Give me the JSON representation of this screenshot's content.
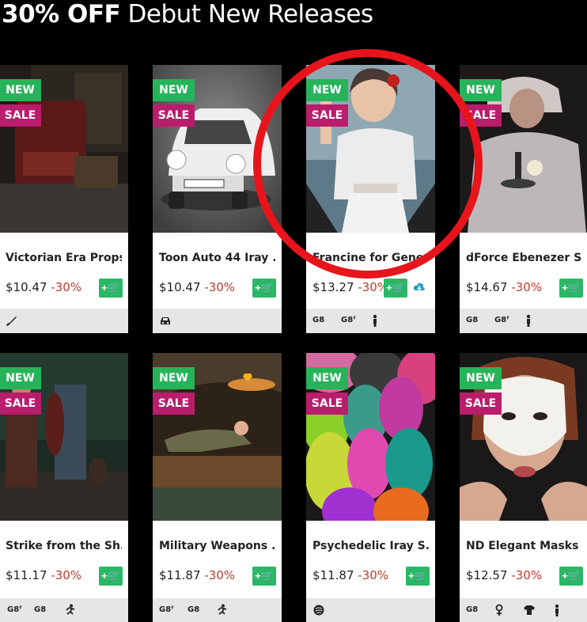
{
  "heading": {
    "bold": "30% OFF",
    "rest": " Debut New Releases"
  },
  "badges": {
    "new": "NEW",
    "sale": "SALE"
  },
  "products": [
    {
      "title": "Victorian Era Props",
      "price": "$10.47",
      "discount": "-30%",
      "cart": "+🛒",
      "tags": [
        "sword-icon"
      ]
    },
    {
      "title": "Toon Auto 44 Iray ...",
      "price": "$10.47",
      "discount": "-30%",
      "cart": "+🛒",
      "tags": [
        "car-icon"
      ]
    },
    {
      "title": "Francine for Gene...",
      "price": "$13.27",
      "discount": "-30%",
      "cart": "+🛒",
      "tags": [
        "G8",
        "G8f",
        "figure-icon"
      ]
    },
    {
      "title": "dForce Ebenezer S...",
      "price": "$14.67",
      "discount": "-30%",
      "cart": "+🛒",
      "tags": [
        "G8",
        "G8f",
        "figure-icon"
      ]
    },
    {
      "title": "Strike from the Sh...",
      "price": "$11.17",
      "discount": "-30%",
      "cart": "+🛒",
      "tags": [
        "G8f",
        "G8",
        "running-icon"
      ]
    },
    {
      "title": "Military Weapons ...",
      "price": "$11.87",
      "discount": "-30%",
      "cart": "+🛒",
      "tags": [
        "G8f",
        "G8",
        "running-icon"
      ]
    },
    {
      "title": "Psychedelic Iray S...",
      "price": "$11.87",
      "discount": "-30%",
      "cart": "+🛒",
      "tags": [
        "shader-icon"
      ]
    },
    {
      "title": "ND Elegant Masks ...",
      "price": "$12.57",
      "discount": "-30%",
      "cart": "+🛒",
      "tags": [
        "G8",
        "female-icon",
        "shirt-icon",
        "figure-icon"
      ]
    }
  ],
  "footer_labels": {
    "g8": "G8",
    "g8f": "G8ᶠ"
  },
  "colors": {
    "new_badge": "#27b35a",
    "sale_badge": "#b81e6b",
    "cart": "#2ab866",
    "discount": "#c0392b",
    "annotation": "#e8141b"
  }
}
